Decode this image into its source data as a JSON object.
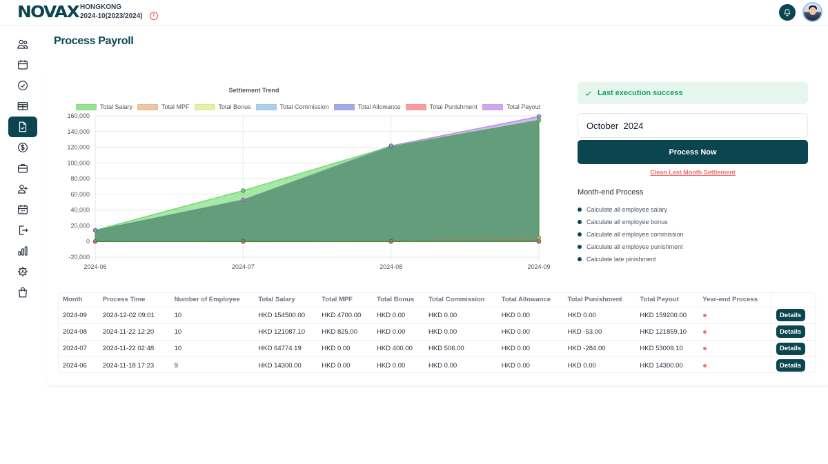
{
  "header": {
    "brand": "NOVAX",
    "region": "HONGKONG",
    "period": "2024-10(2023/2024)",
    "warning_icon": "alert-circle-icon",
    "bell_icon": "bell-icon",
    "avatar_icon": "user-avatar"
  },
  "sidebar": {
    "items": [
      {
        "name": "employees",
        "icon": "users-icon",
        "active": false
      },
      {
        "name": "calendar",
        "icon": "calendar-icon",
        "active": false
      },
      {
        "name": "approvals",
        "icon": "check-circle-icon",
        "active": false
      },
      {
        "name": "timesheet",
        "icon": "table-icon",
        "active": false
      },
      {
        "name": "payroll",
        "icon": "file-check-icon",
        "active": true
      },
      {
        "name": "finance",
        "icon": "dollar-circle-icon",
        "active": false
      },
      {
        "name": "jobs",
        "icon": "briefcase-icon",
        "active": false
      },
      {
        "name": "recruitment",
        "icon": "user-plus-icon",
        "active": false
      },
      {
        "name": "schedule",
        "icon": "calendar-grid-icon",
        "active": false
      },
      {
        "name": "logout-records",
        "icon": "exit-icon",
        "active": false
      },
      {
        "name": "reports",
        "icon": "bar-chart-icon",
        "active": false
      },
      {
        "name": "settings",
        "icon": "gear-icon",
        "active": false
      },
      {
        "name": "shop",
        "icon": "shopping-bag-icon",
        "active": false
      }
    ]
  },
  "page": {
    "title": "Process Payroll"
  },
  "status": {
    "icon": "check-icon",
    "text": "Last execution success",
    "color": "#16a062"
  },
  "process_form": {
    "month_value": "October  2024",
    "process_label": "Process Now",
    "clean_label": "Clean Last Month Settlement"
  },
  "month_end": {
    "title": "Month-end Process",
    "items": [
      "Calculate all employee salary",
      "Calculate all employee bonus",
      "Calculate all employee commission",
      "Calculate all employee punishment",
      "Calculate late pinishment"
    ]
  },
  "chart_data": {
    "type": "area",
    "title": "Settlement Trend",
    "categories": [
      "2024-06",
      "2024-07",
      "2024-08",
      "2024-09"
    ],
    "ylim": [
      -20000,
      160000
    ],
    "yticks": [
      160000,
      140000,
      120000,
      100000,
      80000,
      60000,
      40000,
      20000,
      0,
      -20000
    ],
    "ytick_labels": [
      "160,000",
      "140,000",
      "120,000",
      "100,000",
      "80,000",
      "60,000",
      "40,000",
      "20,000",
      "0",
      "-20,000"
    ],
    "grid": true,
    "legend_position": "top",
    "series": [
      {
        "name": "Total Salary",
        "values": [
          14300,
          64774.19,
          121087.1,
          154500
        ],
        "color": "#5cd65c"
      },
      {
        "name": "Total MPF",
        "values": [
          0,
          0,
          825,
          4700
        ],
        "color": "#e8a970"
      },
      {
        "name": "Total Bonus",
        "values": [
          0,
          400,
          0,
          0
        ],
        "color": "#d4ee78"
      },
      {
        "name": "Total Commission",
        "values": [
          0,
          506,
          0,
          0
        ],
        "color": "#7fb8e8"
      },
      {
        "name": "Total Allowance",
        "values": [
          0,
          0,
          0,
          0
        ],
        "color": "#6f7fe0"
      },
      {
        "name": "Total Punishment",
        "values": [
          0,
          -284,
          -53,
          0
        ],
        "color": "#f26b6b"
      },
      {
        "name": "Total Payout",
        "values": [
          14300,
          53009.1,
          121859.1,
          159200
        ],
        "color": "#b779e8"
      }
    ]
  },
  "table": {
    "columns": [
      "Month",
      "Process Time",
      "Number of Employee",
      "Total Salary",
      "Total MPF",
      "Total Bonus",
      "Total Commission",
      "Total Allowance",
      "Total Punishment",
      "Total Payout",
      "Year-end Process",
      ""
    ],
    "rows": [
      {
        "month": "2024-09",
        "process_time": "2024-12-02 09:01",
        "employees": "10",
        "salary": "HKD 154500.00",
        "mpf": "HKD 4700.00",
        "bonus": "HKD 0.00",
        "commission": "HKD 0.00",
        "allowance": "HKD 0.00",
        "punishment": "HKD 0.00",
        "payout": "HKD 159200.00",
        "year_end": "pending",
        "action": "Details"
      },
      {
        "month": "2024-08",
        "process_time": "2024-11-22 12:20",
        "employees": "10",
        "salary": "HKD 121087.10",
        "mpf": "HKD 825.00",
        "bonus": "HKD 0.00",
        "commission": "HKD 0.00",
        "allowance": "HKD 0.00",
        "punishment": "HKD -53.00",
        "payout": "HKD 121859.10",
        "year_end": "pending",
        "action": "Details"
      },
      {
        "month": "2024-07",
        "process_time": "2024-11-22 02:48",
        "employees": "10",
        "salary": "HKD 64774.19",
        "mpf": "HKD 0.00",
        "bonus": "HKD 400.00",
        "commission": "HKD 506.00",
        "allowance": "HKD 0.00",
        "punishment": "HKD -284.00",
        "payout": "HKD 53009.10",
        "year_end": "pending",
        "action": "Details"
      },
      {
        "month": "2024-06",
        "process_time": "2024-11-18 17:23",
        "employees": "9",
        "salary": "HKD 14300.00",
        "mpf": "HKD 0.00",
        "bonus": "HKD 0.00",
        "commission": "HKD 0.00",
        "allowance": "HKD 0.00",
        "punishment": "HKD 0.00",
        "payout": "HKD 14300.00",
        "year_end": "pending",
        "action": "Details"
      }
    ]
  },
  "colors": {
    "brand": "#0b4550",
    "danger": "#f26b6b",
    "success": "#16a062"
  }
}
